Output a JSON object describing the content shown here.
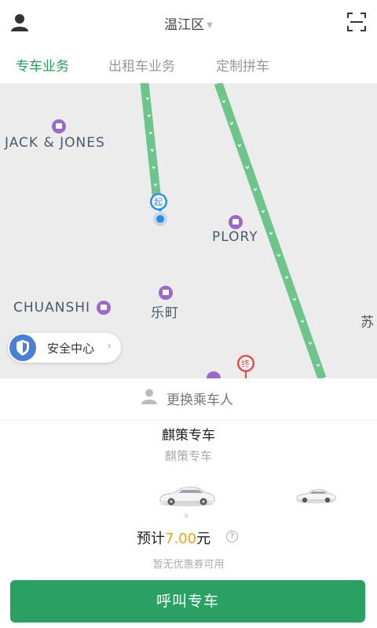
{
  "header": {
    "city": "温江区",
    "user_icon": "user-icon",
    "scan_icon": "scan-icon"
  },
  "tabs": [
    {
      "label": "专车业务",
      "active": true
    },
    {
      "label": "出租车业务",
      "active": false
    },
    {
      "label": "定制拼车",
      "active": false
    }
  ],
  "map": {
    "pois": [
      {
        "label": "JACK & JONES"
      },
      {
        "label": "PLORY"
      },
      {
        "label": "CHUANSHI"
      },
      {
        "label": "乐町"
      },
      {
        "label": "苏"
      }
    ],
    "start_marker": "起",
    "end_marker": "终",
    "route_color": "#6cc58a",
    "start_color": "#2d8de0",
    "end_color": "#e84a4a"
  },
  "safety_center": {
    "label": "安全中心"
  },
  "panel": {
    "change_passenger": "更换乘车人",
    "car_title": "麒策专车",
    "car_subtitle": "麒策专车",
    "price_prefix": "预计",
    "price_amount": "7.00",
    "price_unit": "元",
    "help_mark": "?",
    "coupon_text": "暂无优惠券可用",
    "call_button": "呼叫专车"
  },
  "colors": {
    "brand_green": "#2aa163",
    "tab_active": "#2a9b5f",
    "price_orange": "#f0a31e"
  }
}
